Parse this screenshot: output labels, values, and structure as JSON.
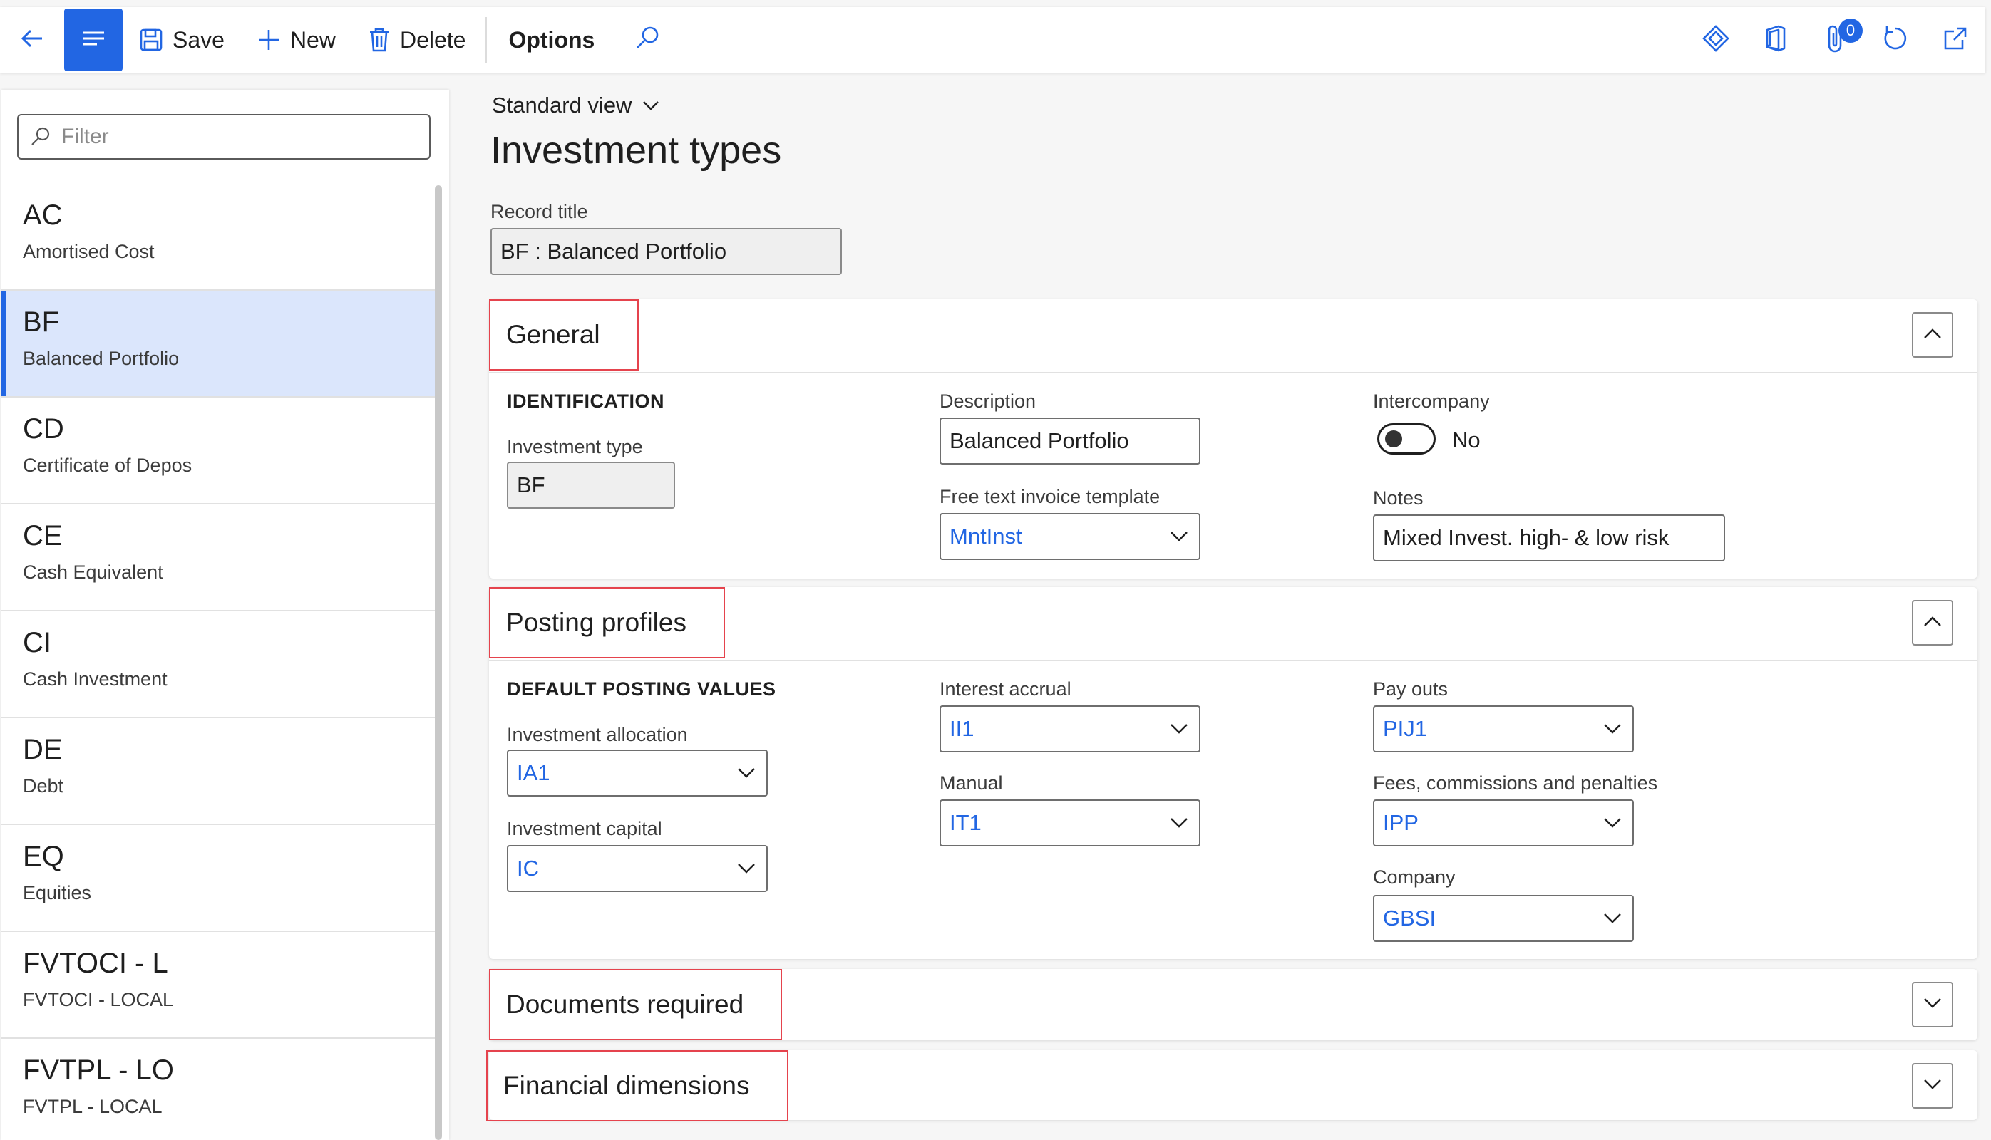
{
  "toolbar": {
    "save_label": "Save",
    "new_label": "New",
    "delete_label": "Delete",
    "options_label": "Options",
    "attachments_count": "0"
  },
  "list": {
    "filter_placeholder": "Filter",
    "items": [
      {
        "code": "AC",
        "desc": "Amortised Cost"
      },
      {
        "code": "BF",
        "desc": "Balanced Portfolio"
      },
      {
        "code": "CD",
        "desc": "Certificate of Depos"
      },
      {
        "code": "CE",
        "desc": "Cash Equivalent"
      },
      {
        "code": "CI",
        "desc": "Cash Investment"
      },
      {
        "code": "DE",
        "desc": "Debt"
      },
      {
        "code": "EQ",
        "desc": "Equities"
      },
      {
        "code": "FVTOCI - L",
        "desc": "FVTOCI - LOCAL"
      },
      {
        "code": "FVTPL - LO",
        "desc": "FVTPL - LOCAL"
      }
    ],
    "selected_index": 1
  },
  "main": {
    "view_label": "Standard view",
    "title": "Investment types",
    "record_title_label": "Record title",
    "record_title_value": "BF : Balanced Portfolio"
  },
  "general": {
    "title": "General",
    "identification_label": "IDENTIFICATION",
    "investment_type_label": "Investment type",
    "investment_type_value": "BF",
    "description_label": "Description",
    "description_value": "Balanced Portfolio",
    "free_text_label": "Free text invoice template",
    "free_text_value": "MntInst",
    "intercompany_label": "Intercompany",
    "intercompany_value": "No",
    "notes_label": "Notes",
    "notes_value": "Mixed Invest. high- & low risk"
  },
  "posting": {
    "title": "Posting profiles",
    "group_label": "DEFAULT POSTING VALUES",
    "inv_alloc_label": "Investment allocation",
    "inv_alloc_value": "IA1",
    "inv_capital_label": "Investment capital",
    "inv_capital_value": "IC",
    "interest_label": "Interest accrual",
    "interest_value": "II1",
    "manual_label": "Manual",
    "manual_value": "IT1",
    "payouts_label": "Pay outs",
    "payouts_value": "PIJ1",
    "fees_label": "Fees, commissions and penalties",
    "fees_value": "IPP",
    "company_label": "Company",
    "company_value": "GBSI"
  },
  "documents": {
    "title": "Documents required"
  },
  "financial": {
    "title": "Financial dimensions"
  },
  "colors": {
    "accent": "#2266e3",
    "selected_bg": "#dbe6fc",
    "highlight": "#e5434d"
  }
}
